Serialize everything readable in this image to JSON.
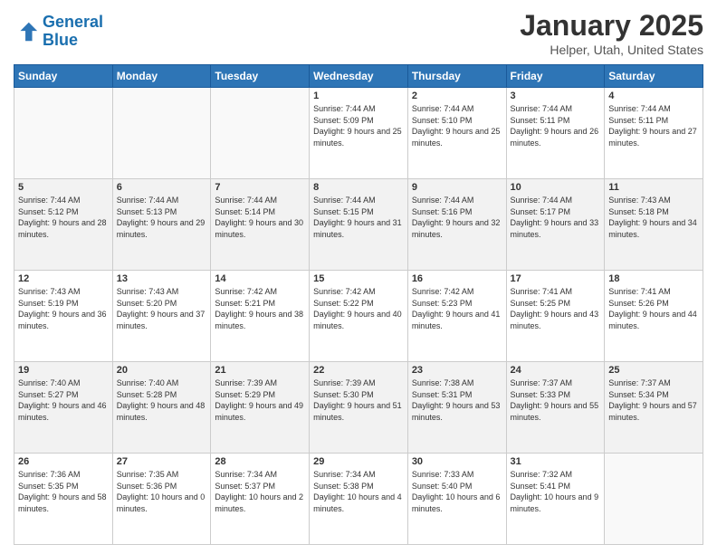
{
  "header": {
    "logo_line1": "General",
    "logo_line2": "Blue",
    "month_title": "January 2025",
    "location": "Helper, Utah, United States"
  },
  "days_of_week": [
    "Sunday",
    "Monday",
    "Tuesday",
    "Wednesday",
    "Thursday",
    "Friday",
    "Saturday"
  ],
  "weeks": [
    [
      {
        "day": "",
        "sunrise": "",
        "sunset": "",
        "daylight": ""
      },
      {
        "day": "",
        "sunrise": "",
        "sunset": "",
        "daylight": ""
      },
      {
        "day": "",
        "sunrise": "",
        "sunset": "",
        "daylight": ""
      },
      {
        "day": "1",
        "sunrise": "Sunrise: 7:44 AM",
        "sunset": "Sunset: 5:09 PM",
        "daylight": "Daylight: 9 hours and 25 minutes."
      },
      {
        "day": "2",
        "sunrise": "Sunrise: 7:44 AM",
        "sunset": "Sunset: 5:10 PM",
        "daylight": "Daylight: 9 hours and 25 minutes."
      },
      {
        "day": "3",
        "sunrise": "Sunrise: 7:44 AM",
        "sunset": "Sunset: 5:11 PM",
        "daylight": "Daylight: 9 hours and 26 minutes."
      },
      {
        "day": "4",
        "sunrise": "Sunrise: 7:44 AM",
        "sunset": "Sunset: 5:11 PM",
        "daylight": "Daylight: 9 hours and 27 minutes."
      }
    ],
    [
      {
        "day": "5",
        "sunrise": "Sunrise: 7:44 AM",
        "sunset": "Sunset: 5:12 PM",
        "daylight": "Daylight: 9 hours and 28 minutes."
      },
      {
        "day": "6",
        "sunrise": "Sunrise: 7:44 AM",
        "sunset": "Sunset: 5:13 PM",
        "daylight": "Daylight: 9 hours and 29 minutes."
      },
      {
        "day": "7",
        "sunrise": "Sunrise: 7:44 AM",
        "sunset": "Sunset: 5:14 PM",
        "daylight": "Daylight: 9 hours and 30 minutes."
      },
      {
        "day": "8",
        "sunrise": "Sunrise: 7:44 AM",
        "sunset": "Sunset: 5:15 PM",
        "daylight": "Daylight: 9 hours and 31 minutes."
      },
      {
        "day": "9",
        "sunrise": "Sunrise: 7:44 AM",
        "sunset": "Sunset: 5:16 PM",
        "daylight": "Daylight: 9 hours and 32 minutes."
      },
      {
        "day": "10",
        "sunrise": "Sunrise: 7:44 AM",
        "sunset": "Sunset: 5:17 PM",
        "daylight": "Daylight: 9 hours and 33 minutes."
      },
      {
        "day": "11",
        "sunrise": "Sunrise: 7:43 AM",
        "sunset": "Sunset: 5:18 PM",
        "daylight": "Daylight: 9 hours and 34 minutes."
      }
    ],
    [
      {
        "day": "12",
        "sunrise": "Sunrise: 7:43 AM",
        "sunset": "Sunset: 5:19 PM",
        "daylight": "Daylight: 9 hours and 36 minutes."
      },
      {
        "day": "13",
        "sunrise": "Sunrise: 7:43 AM",
        "sunset": "Sunset: 5:20 PM",
        "daylight": "Daylight: 9 hours and 37 minutes."
      },
      {
        "day": "14",
        "sunrise": "Sunrise: 7:42 AM",
        "sunset": "Sunset: 5:21 PM",
        "daylight": "Daylight: 9 hours and 38 minutes."
      },
      {
        "day": "15",
        "sunrise": "Sunrise: 7:42 AM",
        "sunset": "Sunset: 5:22 PM",
        "daylight": "Daylight: 9 hours and 40 minutes."
      },
      {
        "day": "16",
        "sunrise": "Sunrise: 7:42 AM",
        "sunset": "Sunset: 5:23 PM",
        "daylight": "Daylight: 9 hours and 41 minutes."
      },
      {
        "day": "17",
        "sunrise": "Sunrise: 7:41 AM",
        "sunset": "Sunset: 5:25 PM",
        "daylight": "Daylight: 9 hours and 43 minutes."
      },
      {
        "day": "18",
        "sunrise": "Sunrise: 7:41 AM",
        "sunset": "Sunset: 5:26 PM",
        "daylight": "Daylight: 9 hours and 44 minutes."
      }
    ],
    [
      {
        "day": "19",
        "sunrise": "Sunrise: 7:40 AM",
        "sunset": "Sunset: 5:27 PM",
        "daylight": "Daylight: 9 hours and 46 minutes."
      },
      {
        "day": "20",
        "sunrise": "Sunrise: 7:40 AM",
        "sunset": "Sunset: 5:28 PM",
        "daylight": "Daylight: 9 hours and 48 minutes."
      },
      {
        "day": "21",
        "sunrise": "Sunrise: 7:39 AM",
        "sunset": "Sunset: 5:29 PM",
        "daylight": "Daylight: 9 hours and 49 minutes."
      },
      {
        "day": "22",
        "sunrise": "Sunrise: 7:39 AM",
        "sunset": "Sunset: 5:30 PM",
        "daylight": "Daylight: 9 hours and 51 minutes."
      },
      {
        "day": "23",
        "sunrise": "Sunrise: 7:38 AM",
        "sunset": "Sunset: 5:31 PM",
        "daylight": "Daylight: 9 hours and 53 minutes."
      },
      {
        "day": "24",
        "sunrise": "Sunrise: 7:37 AM",
        "sunset": "Sunset: 5:33 PM",
        "daylight": "Daylight: 9 hours and 55 minutes."
      },
      {
        "day": "25",
        "sunrise": "Sunrise: 7:37 AM",
        "sunset": "Sunset: 5:34 PM",
        "daylight": "Daylight: 9 hours and 57 minutes."
      }
    ],
    [
      {
        "day": "26",
        "sunrise": "Sunrise: 7:36 AM",
        "sunset": "Sunset: 5:35 PM",
        "daylight": "Daylight: 9 hours and 58 minutes."
      },
      {
        "day": "27",
        "sunrise": "Sunrise: 7:35 AM",
        "sunset": "Sunset: 5:36 PM",
        "daylight": "Daylight: 10 hours and 0 minutes."
      },
      {
        "day": "28",
        "sunrise": "Sunrise: 7:34 AM",
        "sunset": "Sunset: 5:37 PM",
        "daylight": "Daylight: 10 hours and 2 minutes."
      },
      {
        "day": "29",
        "sunrise": "Sunrise: 7:34 AM",
        "sunset": "Sunset: 5:38 PM",
        "daylight": "Daylight: 10 hours and 4 minutes."
      },
      {
        "day": "30",
        "sunrise": "Sunrise: 7:33 AM",
        "sunset": "Sunset: 5:40 PM",
        "daylight": "Daylight: 10 hours and 6 minutes."
      },
      {
        "day": "31",
        "sunrise": "Sunrise: 7:32 AM",
        "sunset": "Sunset: 5:41 PM",
        "daylight": "Daylight: 10 hours and 9 minutes."
      },
      {
        "day": "",
        "sunrise": "",
        "sunset": "",
        "daylight": ""
      }
    ]
  ]
}
